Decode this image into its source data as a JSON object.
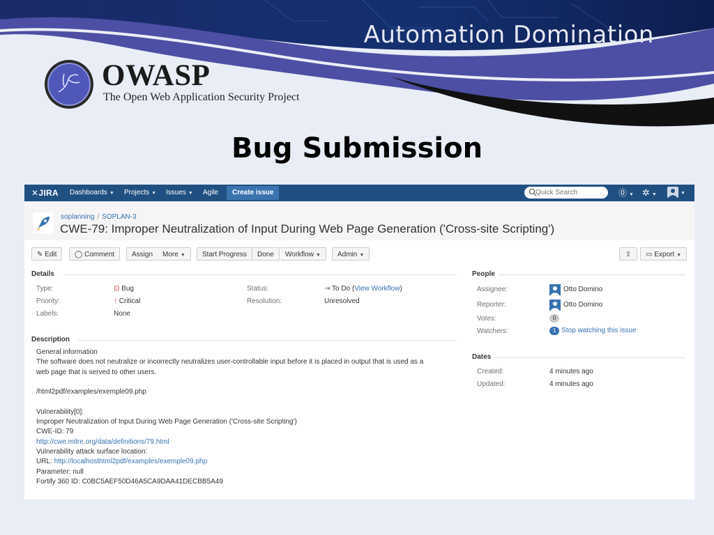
{
  "slide": {
    "deck_title": "Automation Domination",
    "org_name": "OWASP",
    "org_tagline": "The Open Web Application Security Project",
    "title": "Bug Submission"
  },
  "colors": {
    "nav_bg": "#205081",
    "create_btn": "#3b73af",
    "link": "#3572b0",
    "slide_band": "#4c4fa3"
  },
  "jira": {
    "nav": {
      "logo": "JIRA",
      "items": [
        "Dashboards",
        "Projects",
        "Issues",
        "Agile"
      ],
      "create_label": "Create issue",
      "search_placeholder": "Quick Search",
      "icons": [
        "help-icon",
        "gear-icon",
        "user-icon"
      ]
    },
    "breadcrumb": {
      "project": "soplanning",
      "issue_key": "SOPLAN-3"
    },
    "summary": "CWE-79: Improper Neutralization of Input During Web Page Generation ('Cross-site Scripting')",
    "toolbar": {
      "edit": "Edit",
      "comment": "Comment",
      "assign": "Assign",
      "more": "More",
      "start_progress": "Start Progress",
      "done": "Done",
      "workflow": "Workflow",
      "admin": "Admin",
      "export": "Export"
    },
    "details": {
      "heading": "Details",
      "type_label": "Type:",
      "type_value": "Bug",
      "priority_label": "Priority:",
      "priority_value": "Critical",
      "labels_label": "Labels:",
      "labels_value": "None",
      "status_label": "Status:",
      "status_value": "To Do",
      "view_workflow": "View Workflow",
      "resolution_label": "Resolution:",
      "resolution_value": "Unresolved"
    },
    "description": {
      "heading": "Description",
      "lines": [
        {
          "text": "General information",
          "link": false
        },
        {
          "text": "The software does not neutralize or incorrectly neutralizes user-controllable input before it is placed in output that is used as a",
          "link": false
        },
        {
          "text": "web page that is served to other users.",
          "link": false
        },
        {
          "text": "",
          "link": false
        },
        {
          "text": "/html2pdf/examples/exemple09.php",
          "link": false
        },
        {
          "text": "",
          "link": false
        },
        {
          "text": "Vulnerability[0]:",
          "link": false
        },
        {
          "text": "Improper Neutralization of Input During Web Page Generation ('Cross-site Scripting')",
          "link": false
        },
        {
          "text": "CWE-ID: 79",
          "link": false
        },
        {
          "text": "http://cwe.mitre.org/data/definitions/79.html",
          "link": true
        },
        {
          "text": "Vulnerability attack surface location:",
          "link": false
        },
        {
          "prefix": "URL: ",
          "text": "http://localhosthtml2pdf/examples/exemple09.php",
          "link": true
        },
        {
          "text": "Parameter: null",
          "link": false
        },
        {
          "text": "Fortify 360 ID: C0BC5AEF50D46A5CA9DAA41DECBB5A49",
          "link": false
        }
      ]
    },
    "people": {
      "heading": "People",
      "assignee_label": "Assignee:",
      "assignee": "Otto Domino",
      "reporter_label": "Reporter:",
      "reporter": "Otto Domino",
      "votes_label": "Votes:",
      "votes": "0",
      "watchers_label": "Watchers:",
      "watchers_count": "1",
      "watch_link": "Stop watching this issue"
    },
    "dates": {
      "heading": "Dates",
      "created_label": "Created:",
      "created": "4 minutes ago",
      "updated_label": "Updated:",
      "updated": "4 minutes ago"
    }
  }
}
